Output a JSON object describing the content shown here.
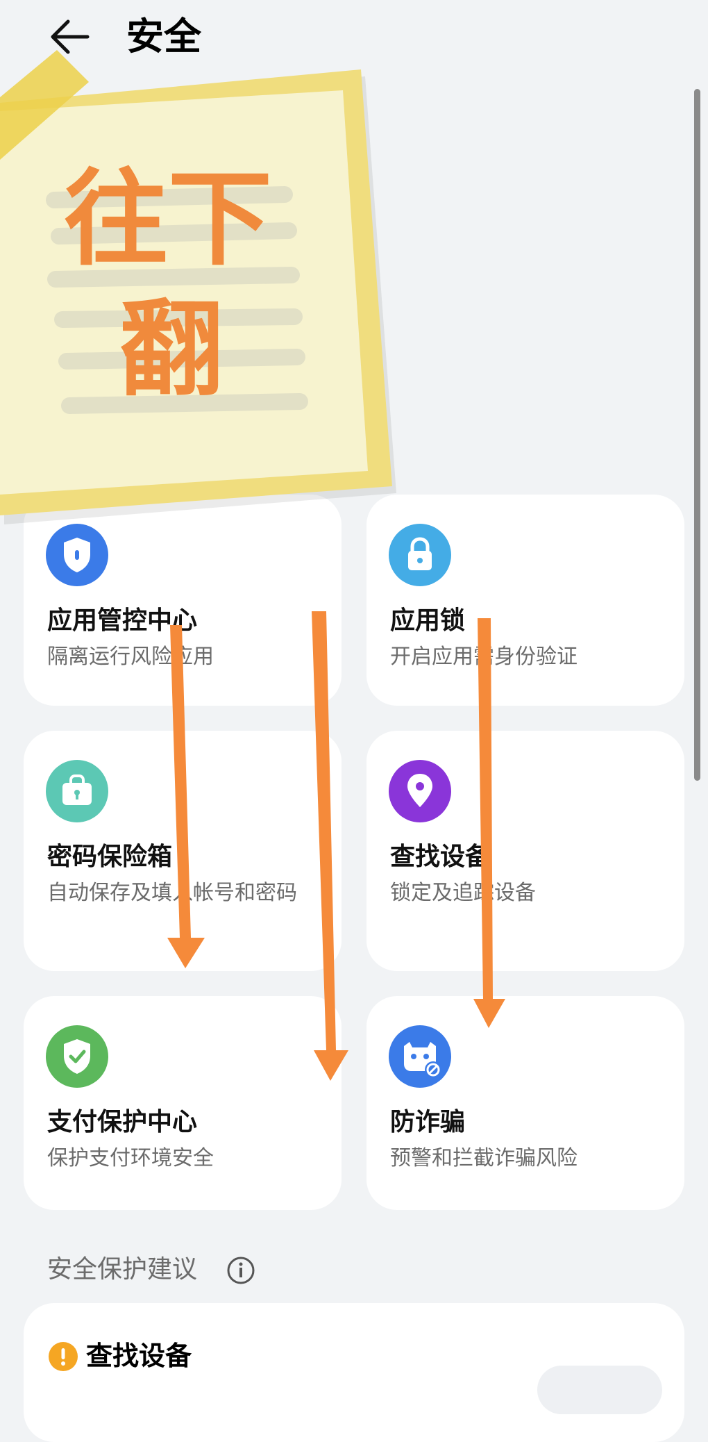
{
  "header": {
    "title": "安全"
  },
  "cards": [
    {
      "title": "应用管控中心",
      "subtitle": "隔离运行风险应用",
      "icon": "shield-icon",
      "color": "#3b7be8"
    },
    {
      "title": "应用锁",
      "subtitle": "开启应用需身份验证",
      "icon": "lock-icon",
      "color": "#44ace6"
    },
    {
      "title": "密码保险箱",
      "subtitle": "自动保存及填入帐号和密码",
      "icon": "safe-icon",
      "color": "#5cc8b4"
    },
    {
      "title": "查找设备",
      "subtitle": "锁定及追踪设备",
      "icon": "location-pin-icon",
      "color": "#8a35d9"
    },
    {
      "title": "支付保护中心",
      "subtitle": "保护支付环境安全",
      "icon": "shield-check-icon",
      "color": "#5cb85c"
    },
    {
      "title": "防诈骗",
      "subtitle": "预警和拦截诈骗风险",
      "icon": "anti-fraud-icon",
      "color": "#3b7be8"
    }
  ],
  "suggestions": {
    "section_title": "安全保护建议",
    "items": [
      {
        "title": "查找设备",
        "icon": "warning-icon",
        "color": "#f5a623"
      }
    ]
  },
  "overlay": {
    "note_line1": "往下",
    "note_line2": "翻",
    "note_color": "#f08a3c",
    "arrow_color": "#f58a3a"
  }
}
